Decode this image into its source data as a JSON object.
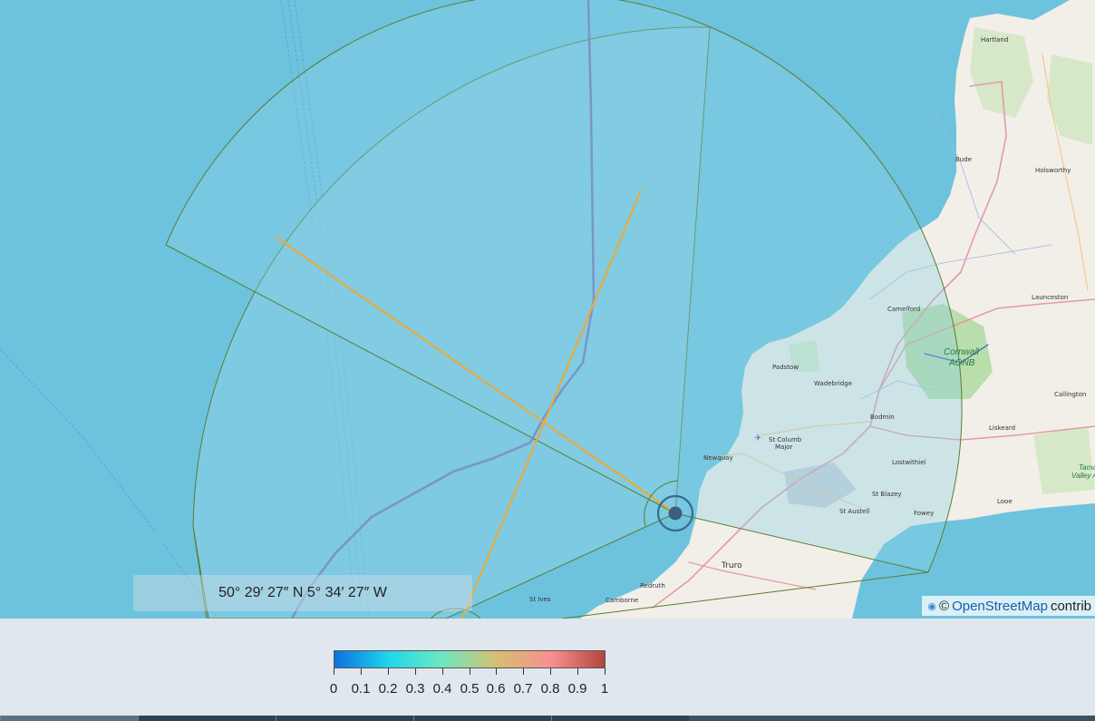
{
  "map": {
    "coordinates": "50° 29′ 27″ N 5° 34′ 27″ W",
    "attribution_prefix": "©",
    "attribution_link": "OpenStreetMap",
    "attribution_suffix": "contrib",
    "aonb_line1": "Cornwall",
    "aonb_line2": "AONB",
    "aonb_east_line1": "Tamar",
    "aonb_east_line2": "Valley A",
    "places": {
      "hartland": "Hartland",
      "bude": "Bude",
      "holsworthy": "Holsworthy",
      "camelford": "Camelford",
      "launceston": "Launceston",
      "padstow": "Padstow",
      "wadebridge": "Wadebridge",
      "callington": "Callington",
      "bodmin": "Bodmin",
      "liskeard": "Liskeard",
      "st_columb_1": "St Columb",
      "st_columb_2": "Major",
      "newquay": "Newquay",
      "lostwithiel": "Lostwithiel",
      "st_blazey": "St Blazey",
      "st_austell": "St Austell",
      "fowey": "Fowey",
      "looe": "Looe",
      "truro": "Truro",
      "redruth": "Redruth",
      "st_ives": "St Ives",
      "camborne": "Camborne"
    }
  },
  "colorbar": {
    "ticks": [
      "0",
      "0.1",
      "0.2",
      "0.3",
      "0.4",
      "0.5",
      "0.6",
      "0.7",
      "0.8",
      "0.9",
      "1"
    ],
    "colors": [
      "#0d6fe0",
      "#1fd6ee",
      "#6de8c0",
      "#d6c070",
      "#f89090",
      "#b2473c"
    ]
  }
}
